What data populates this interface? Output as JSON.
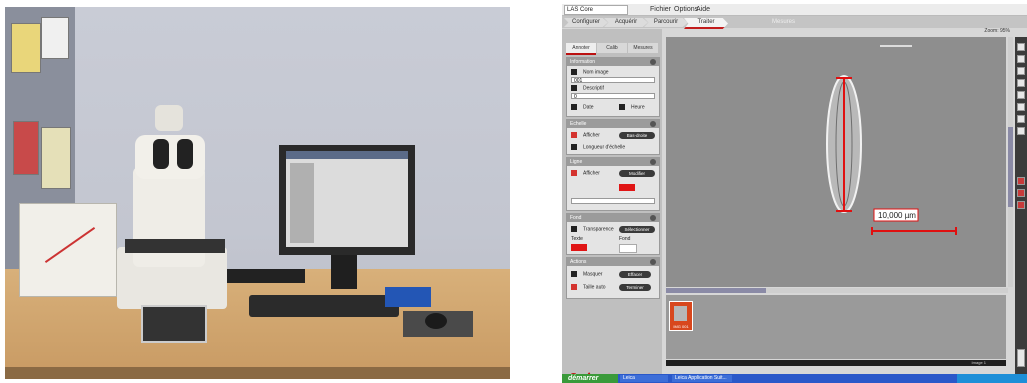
{
  "app": {
    "title": "LAS Core",
    "menus": [
      "Fichier",
      "Options",
      "Aide"
    ]
  },
  "workflow": {
    "tabs": [
      "Configurer",
      "Acquérir",
      "Parcourir",
      "Traiter"
    ],
    "active": "Traiter",
    "center_label": "Mesures"
  },
  "panel": {
    "tabs": [
      "Annoter",
      "Calib",
      "Mesures"
    ],
    "sections": {
      "information": {
        "title": "Information",
        "items": [
          "Nom image",
          "001",
          "Descriptif",
          "0",
          "Date",
          "Heure"
        ]
      },
      "echelle": {
        "title": "Echelle",
        "afficher": "Afficher",
        "afficher_value": "Bas-droite",
        "longueur": "Longueur",
        "longueur_suffix": "d'échelle"
      },
      "ligne": {
        "title": "Ligne",
        "afficher": "Afficher",
        "afficher_value": "Modifier"
      },
      "fond": {
        "title": "Fond",
        "transparence": "Transparence",
        "transparence_value": "Sélectionner",
        "texte": "Texte",
        "fond": "Fond"
      },
      "actions": {
        "title": "Actions",
        "masquer": "Masquer",
        "masquer_value": "Effacer",
        "taille_auto": "Taille auto",
        "taille_auto_value": "Terminer"
      }
    },
    "logo": "Leica"
  },
  "viewer": {
    "zoom": "Zoom: 95%",
    "measure_label": "10,000 µm"
  },
  "filmstrip": {
    "thumb_label": "IMG 001"
  },
  "statusbar": {
    "text": "Image 1"
  },
  "taskbar": {
    "start": "démarrer",
    "tasks": [
      "Leica",
      "Leica Application Suit..."
    ]
  },
  "colors": {
    "accent_red": "#c21d1d",
    "measure_red": "#e01010",
    "taskbar_blue": "#2a58c9",
    "start_green": "#3a9a3a"
  }
}
